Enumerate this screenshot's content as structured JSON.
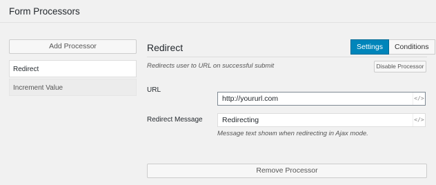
{
  "header": {
    "title": "Form Processors"
  },
  "sidebar": {
    "add_label": "Add Processor",
    "items": [
      {
        "label": "Redirect",
        "active": true
      },
      {
        "label": "Increment Value",
        "active": false
      }
    ]
  },
  "panel": {
    "title": "Redirect",
    "tabs": [
      {
        "label": "Settings",
        "active": true
      },
      {
        "label": "Conditions",
        "active": false
      }
    ],
    "description": "Redirects user to URL on successful submit",
    "disable_label": "Disable Processor",
    "fields": [
      {
        "label": "URL",
        "value": "http://yoururl.com",
        "icon": "code-icon"
      },
      {
        "label": "Redirect Message",
        "value": "Redirecting",
        "icon": "code-icon",
        "help": "Message text shown when redirecting in Ajax mode."
      }
    ],
    "remove_label": "Remove Processor"
  },
  "colors": {
    "accent": "#0085ba",
    "background": "#f1f1f1"
  }
}
